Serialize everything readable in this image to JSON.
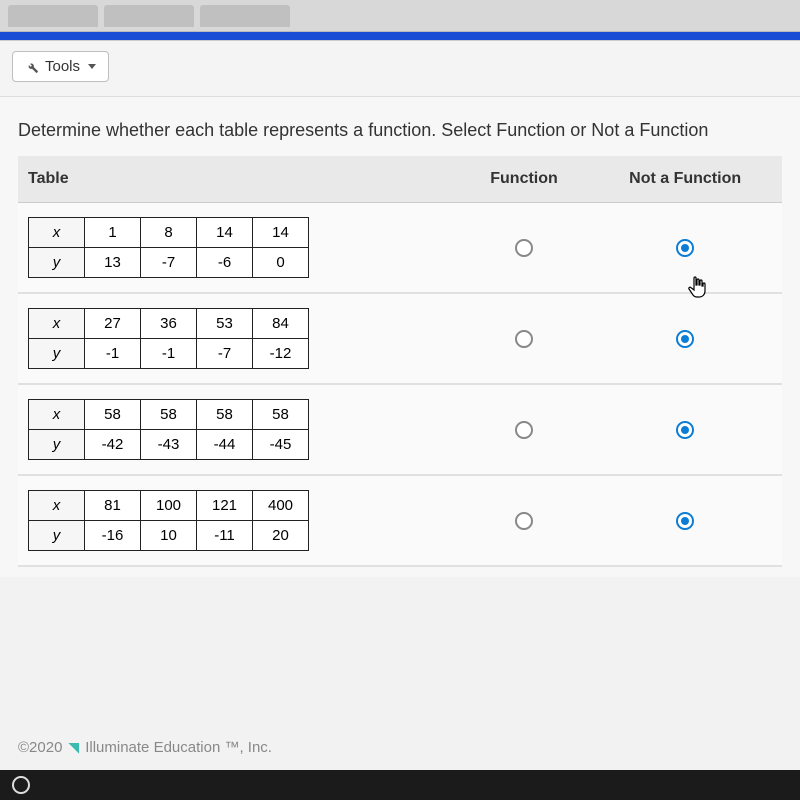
{
  "tools_label": "Tools",
  "prompt": "Determine whether each table represents a function. Select Function or Not a Function",
  "headers": {
    "table": "Table",
    "function": "Function",
    "not_function": "Not a Function"
  },
  "var_labels": {
    "x": "x",
    "y": "y"
  },
  "rows": [
    {
      "x": [
        "1",
        "8",
        "14",
        "14"
      ],
      "y": [
        "13",
        "-7",
        "-6",
        "0"
      ],
      "selected": "not_function"
    },
    {
      "x": [
        "27",
        "36",
        "53",
        "84"
      ],
      "y": [
        "-1",
        "-1",
        "-7",
        "-12"
      ],
      "selected": "not_function"
    },
    {
      "x": [
        "58",
        "58",
        "58",
        "58"
      ],
      "y": [
        "-42",
        "-43",
        "-44",
        "-45"
      ],
      "selected": "not_function"
    },
    {
      "x": [
        "81",
        "100",
        "121",
        "400"
      ],
      "y": [
        "-16",
        "10",
        "-11",
        "20"
      ],
      "selected": "not_function"
    }
  ],
  "footer": "©2020",
  "footer_brand": "Illuminate Education ™, Inc."
}
